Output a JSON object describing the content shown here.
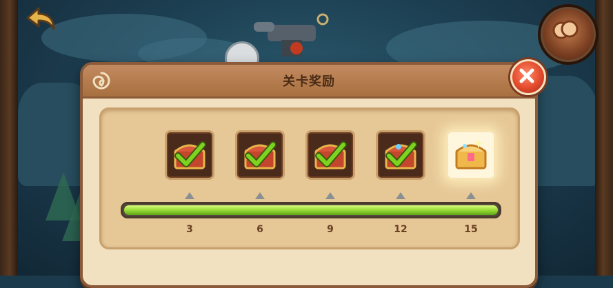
{
  "dialog": {
    "title": "关卡奖励"
  },
  "rewards": {
    "milestones": [
      {
        "label": "3",
        "claimed": true
      },
      {
        "label": "6",
        "claimed": true
      },
      {
        "label": "9",
        "claimed": true
      },
      {
        "label": "12",
        "claimed": true
      },
      {
        "label": "15",
        "claimed": false
      }
    ],
    "progress_fraction": 1.0
  },
  "icons": {
    "back": "back-arrow-icon",
    "close": "close-icon",
    "chest_claimed": "chest-checkmark-icon",
    "chest_ready": "chest-glowing-icon",
    "menu": "round-menu-icon"
  },
  "colors": {
    "progress": "#8cd22c",
    "check": "#7ed321",
    "close": "#e24b2c",
    "panel": "#f1e1c0"
  }
}
